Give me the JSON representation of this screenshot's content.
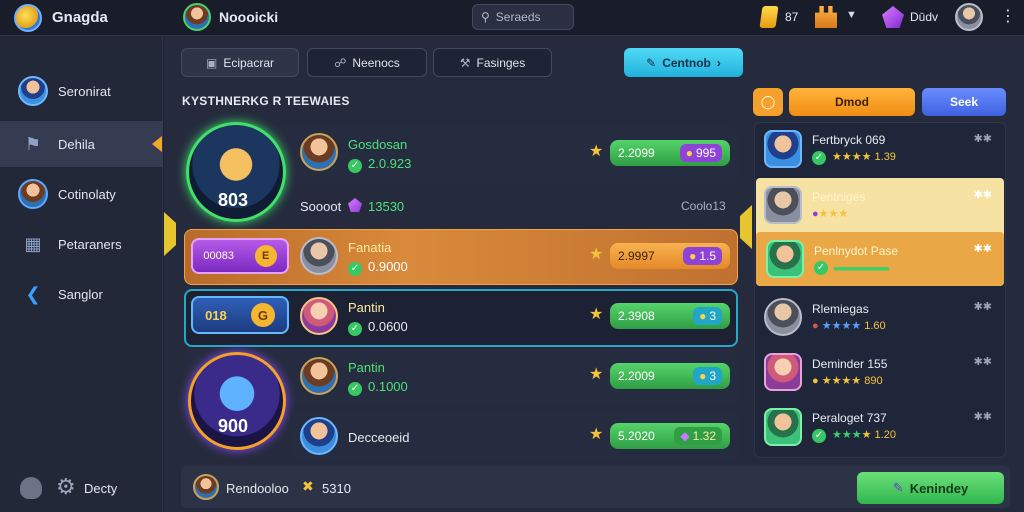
{
  "app": {
    "title": "Gnagda",
    "logo_icon": "game-controller-icon"
  },
  "header": {
    "profile_name": "Noooicki",
    "search_placeholder": "Seraeds",
    "gold_value": "87",
    "gems_label": "Dūdv"
  },
  "sidebar": {
    "items": [
      {
        "label": "Seronirat",
        "icon": "avatar-icon"
      },
      {
        "label": "Dehila",
        "icon": "tag-icon"
      },
      {
        "label": "Cotinolaty",
        "icon": "avatar-icon"
      },
      {
        "label": "Petaraners",
        "icon": "calendar-icon"
      },
      {
        "label": "Sanglor",
        "icon": "share-icon"
      }
    ],
    "bottom": {
      "label": "Decty",
      "icons": [
        "shield-icon",
        "gear-icon"
      ]
    }
  },
  "tabs": [
    {
      "label": "Ecipacrar",
      "icon": "chat-icon"
    },
    {
      "label": "Neenocs",
      "icon": "lock-icon"
    },
    {
      "label": "Fasinges",
      "icon": "tools-icon"
    }
  ],
  "action_button": {
    "label": "Centnob",
    "icon": "edit-icon"
  },
  "section_title": "KYSTHNERKG R TEEWAIES",
  "hero_badges": [
    "803",
    "900"
  ],
  "mid_row": {
    "name": "Soooot",
    "value": "13530",
    "right_label": "Coolo13"
  },
  "rows": [
    {
      "name": "Gosdosan",
      "sub": "2.0.923",
      "pill_value": "2.2099",
      "pill_right": "995"
    },
    {
      "name": "Fanatia",
      "sub": "0.9000",
      "pill_value": "2.9997",
      "pill_right": "1.5",
      "badge_label": "00083",
      "badge_value": "E"
    },
    {
      "name": "Pantin",
      "sub": "0.0600",
      "pill_value": "2.3908",
      "pill_right": "3",
      "badge_label": "018",
      "badge_value": "G"
    },
    {
      "name": "Pantin",
      "sub": "0.1000",
      "pill_value": "2.2009",
      "pill_right": "3"
    },
    {
      "name": "Decceoeid",
      "sub": "",
      "pill_value": "5.2020",
      "pill_right": "1.32"
    }
  ],
  "footer": {
    "name": "Rendooloo",
    "value": "5310",
    "button_label": "Kenindey"
  },
  "right_panel": {
    "orange_button": "Dmod",
    "blue_button": "Seek",
    "leaderboard": [
      {
        "name": "Fertbryck 069",
        "value": "1.39"
      },
      {
        "name": "Pentniges",
        "value": ""
      },
      {
        "name": "Penlnydot Pase",
        "value": ""
      },
      {
        "name": "Rlemiegas",
        "value": "1.60"
      },
      {
        "name": "Deminder 155",
        "value": "890"
      },
      {
        "name": "Peraloget 737",
        "value": "1.20"
      }
    ]
  },
  "colors": {
    "accent_green": "#4fe07a",
    "accent_orange": "#f5a02a",
    "accent_cyan": "#36cbe8",
    "accent_blue": "#4e7bf0",
    "highlight_yellow": "#f6e2a2"
  }
}
